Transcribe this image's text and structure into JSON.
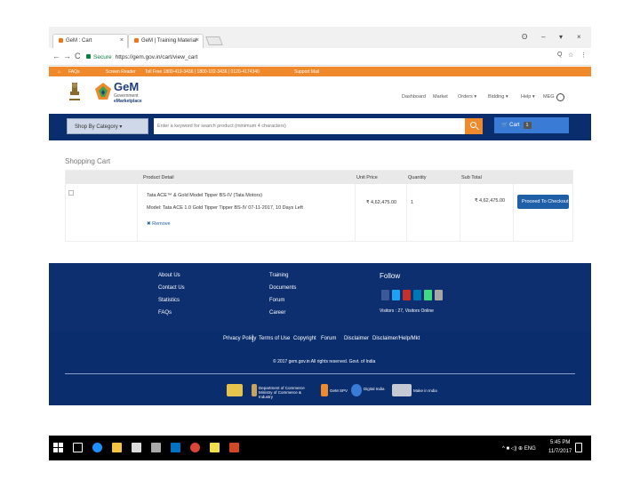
{
  "browser": {
    "tabs": [
      {
        "label": "GeM : Cart"
      },
      {
        "label": "GeM | Training Material"
      }
    ],
    "nav": {
      "back": "←",
      "forward": "→",
      "reload": "C"
    },
    "address": {
      "secure_label": "Secure",
      "url": "https://gem.gov.in/cart/view_cart"
    },
    "window_controls": {
      "account": "ʘ",
      "minimize": "–",
      "restore": "▾",
      "close": "×"
    },
    "addr_icons": {
      "zoom": "Q",
      "star": "☆",
      "menu": "⋮"
    }
  },
  "gem_topbar": {
    "items": [
      "FAQs",
      "Screen Reader",
      "Toll Free 1800-419-3436 | 1800-102-3436 | 0120-4174340",
      "Support Mail"
    ]
  },
  "gem_header": {
    "title": "GeM",
    "subtitle1": "Government",
    "subtitle2": "eMarketplace",
    "nav": [
      "Dashboard",
      "Market",
      "Orders ▾",
      "Bidding ▾",
      "Help ▾",
      "MEG"
    ]
  },
  "search": {
    "category_label": "Shop By Category ▾",
    "placeholder": "Enter a keyword for search product (minimum 4 characters)",
    "cart_label": "Cart",
    "cart_count": "1"
  },
  "cart": {
    "title": "Shopping Cart",
    "columns": [
      "Product Detail",
      "Unit Price",
      "Quantity",
      "Sub Total"
    ],
    "item": {
      "name": "Tata ACE™ & Gold Model Tipper BS-IV (Tata Motors)",
      "model_line": "Model: Tata ACE 1.0 Gold Tipper Tipper BS-IV 07-11-2017, 10 Days Left",
      "unit_price": "₹ 4,62,475.00",
      "quantity": "1",
      "subtotal": "₹ 4,62,475.00",
      "remove_label": "✖ Remove",
      "checkout_label": "Proceed To Checkout"
    }
  },
  "footer": {
    "col1": [
      "About Us",
      "Contact Us",
      "Statistics",
      "FAQs"
    ],
    "col2": [
      "Training",
      "Documents",
      "Forum",
      "Career"
    ],
    "follow_title": "Follow",
    "visitors": "Visitors : 27, Visitors Online",
    "bottom_links": [
      "Privacy Policy",
      "Terms of Use",
      "Copyright",
      "Forum",
      "Disclaimer",
      "Disclaimer/Help/Mkt"
    ],
    "copyright": "© 2017 gem.gov.in All rights reserved. Govt. of India",
    "partners": [
      "Department of Commerce Ministry of Commerce & Industry",
      "GeM SPV",
      "Digital India",
      "Make in India"
    ]
  },
  "taskbar": {
    "time": "5:45 PM",
    "date": "11/7/2017",
    "tray": "^ ■ ◁) ⊕ ENG"
  }
}
